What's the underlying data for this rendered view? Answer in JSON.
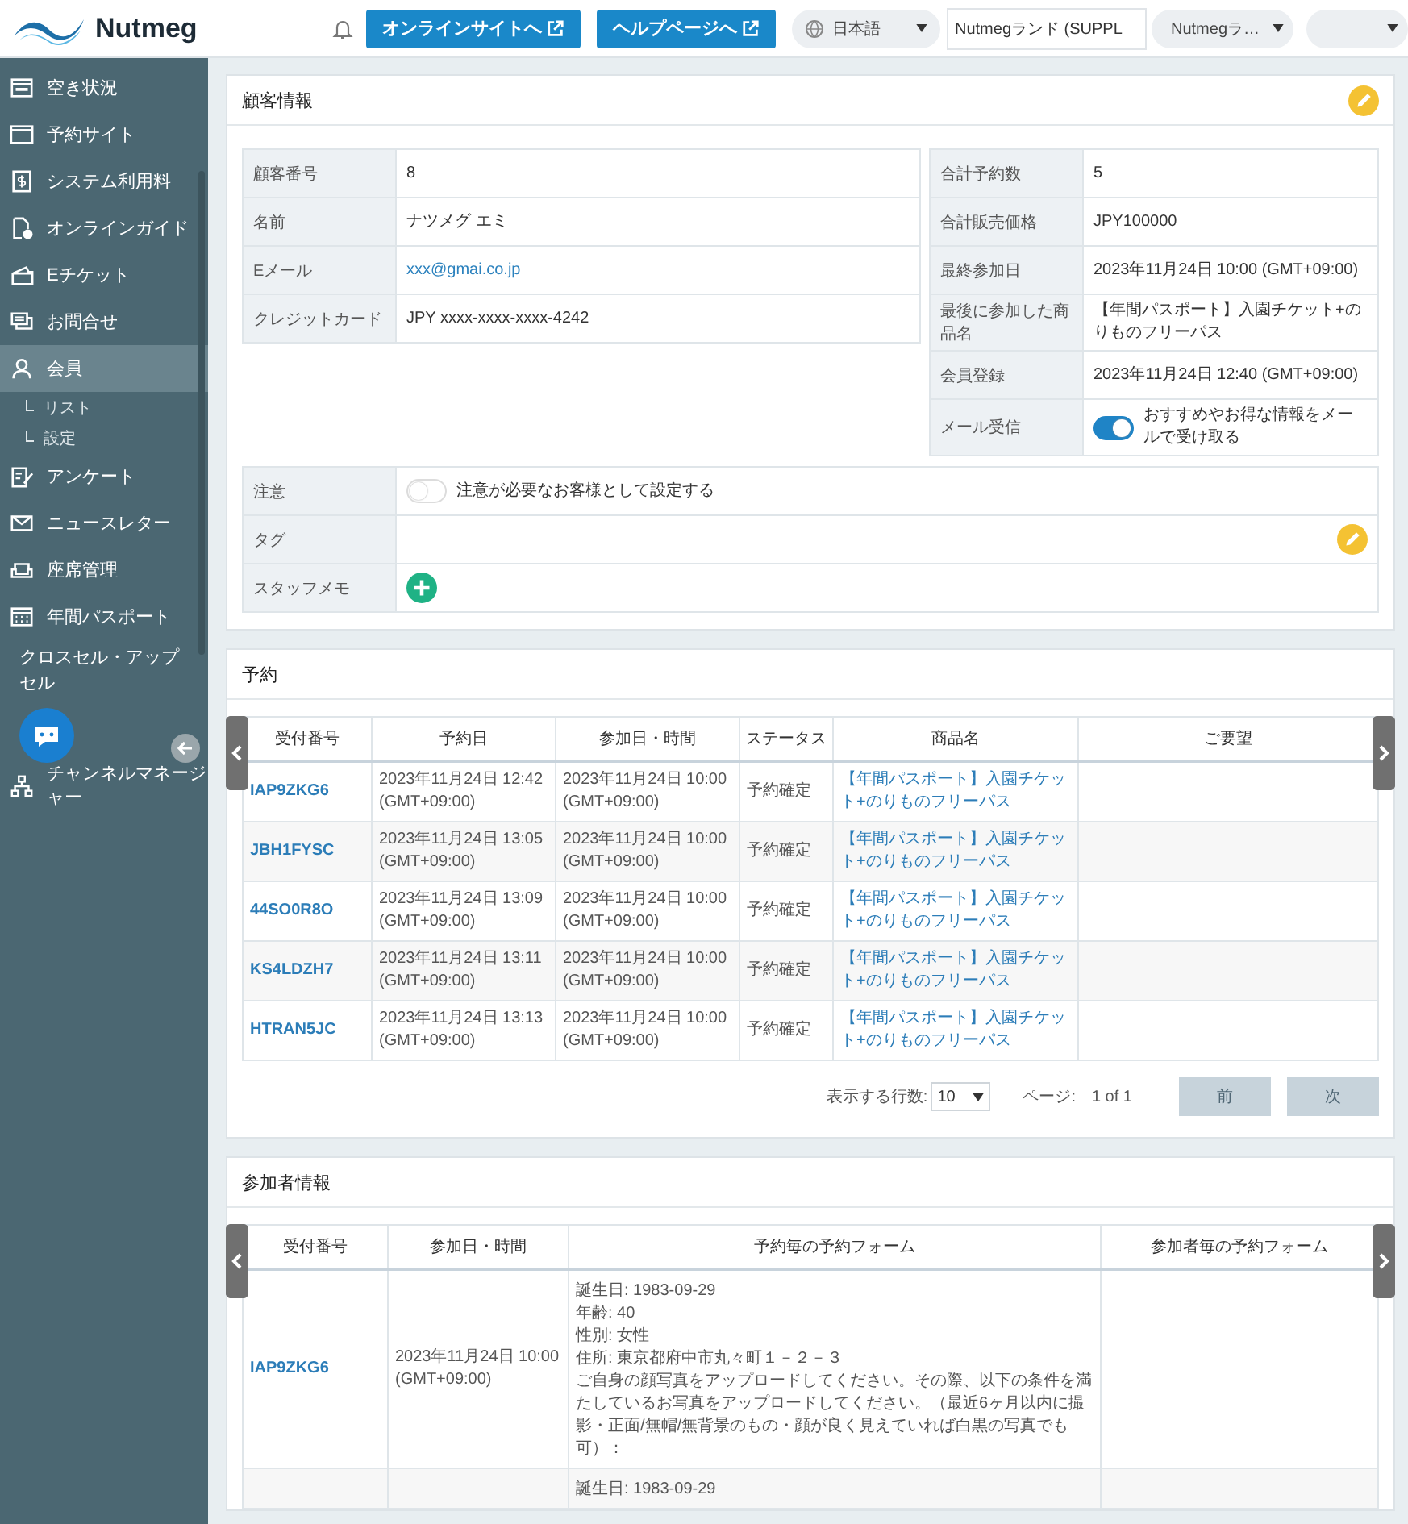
{
  "header": {
    "logo": "Nutmeg",
    "buttons": [
      "オンラインサイトへ",
      "ヘルプページへ"
    ],
    "language": "日本語",
    "site_field": "Nutmegランド (SUPPL",
    "site_select": "Nutmegラ…"
  },
  "sidebar": {
    "items": [
      {
        "label": "空き状況",
        "selected": false
      },
      {
        "label": "予約サイト",
        "selected": false
      },
      {
        "label": "システム利用料",
        "selected": false
      },
      {
        "label": "オンラインガイド",
        "selected": false
      },
      {
        "label": "Eチケット",
        "selected": false
      },
      {
        "label": "お問合せ",
        "selected": false
      },
      {
        "label": "会員",
        "selected": true,
        "children": [
          {
            "label": "リスト"
          },
          {
            "label": "設定"
          }
        ]
      },
      {
        "label": "アンケート",
        "selected": false
      },
      {
        "label": "ニュースレター",
        "selected": false
      },
      {
        "label": "座席管理",
        "selected": false
      },
      {
        "label": "年間パスポート",
        "selected": false
      },
      {
        "label": "クロスセル・アップセル",
        "selected": false
      },
      {
        "label": "チャンネルマネージャー",
        "selected": false
      }
    ]
  },
  "customer": {
    "title": "顧客情報",
    "left_rows": [
      {
        "kind": "text",
        "label": "顧客番号",
        "value": "8"
      },
      {
        "kind": "text",
        "label": "名前",
        "value": "ナツメグ エミ"
      },
      {
        "kind": "link",
        "label": "Eメール",
        "value": "xxx@gmai.co.jp"
      },
      {
        "kind": "text",
        "label": "クレジットカード",
        "value": "JPY xxxx-xxxx-xxxx-4242"
      }
    ],
    "right_rows": [
      {
        "kind": "text",
        "label": "合計予約数",
        "value": "5"
      },
      {
        "kind": "text",
        "label": "合計販売価格",
        "value": "JPY100000"
      },
      {
        "kind": "text",
        "label": "最終参加日",
        "value": "2023年11月24日 10:00 (GMT+09:00)"
      },
      {
        "kind": "text",
        "label": "最後に参加した商品名",
        "value": "【年間パスポート】入園チケット+のりものフリーパス"
      },
      {
        "kind": "text",
        "label": "会員登録",
        "value": "2023年11月24日 12:40 (GMT+09:00)"
      },
      {
        "kind": "toggle",
        "label": "メール受信",
        "on": true,
        "value": "おすすめやお得な情報をメールで受け取る"
      }
    ],
    "bottom_rows": [
      {
        "kind": "toggle",
        "label": "注意",
        "on": false,
        "value": "注意が必要なお客様として設定する"
      },
      {
        "kind": "tag",
        "label": "タグ"
      },
      {
        "kind": "memo",
        "label": "スタッフメモ"
      }
    ]
  },
  "reservations": {
    "title": "予約",
    "columns": [
      "受付番号",
      "予約日",
      "参加日・時間",
      "ステータス",
      "商品名",
      "ご要望"
    ],
    "rows": [
      {
        "id": "IAP9ZKG6",
        "booked": "2023年11月24日 12:42 (GMT+09:00)",
        "date": "2023年11月24日 10:00 (GMT+09:00)",
        "status": "予約確定",
        "product": "【年間パスポート】入園チケット+のりものフリーパス"
      },
      {
        "id": "JBH1FYSC",
        "booked": "2023年11月24日 13:05 (GMT+09:00)",
        "date": "2023年11月24日 10:00 (GMT+09:00)",
        "status": "予約確定",
        "product": "【年間パスポート】入園チケット+のりものフリーパス"
      },
      {
        "id": "44SO0R8O",
        "booked": "2023年11月24日 13:09 (GMT+09:00)",
        "date": "2023年11月24日 10:00 (GMT+09:00)",
        "status": "予約確定",
        "product": "【年間パスポート】入園チケット+のりものフリーパス"
      },
      {
        "id": "KS4LDZH7",
        "booked": "2023年11月24日 13:11 (GMT+09:00)",
        "date": "2023年11月24日 10:00 (GMT+09:00)",
        "status": "予約確定",
        "product": "【年間パスポート】入園チケット+のりものフリーパス"
      },
      {
        "id": "HTRAN5JC",
        "booked": "2023年11月24日 13:13 (GMT+09:00)",
        "date": "2023年11月24日 10:00 (GMT+09:00)",
        "status": "予約確定",
        "product": "【年間パスポート】入園チケット+のりものフリーパス"
      }
    ],
    "pager": {
      "rows_label": "表示する行数:",
      "rows_value": "10",
      "page_label": "ページ:",
      "page_value": "1 of 1",
      "buttons": [
        {
          "label": "前",
          "disabled": true
        },
        {
          "label": "次",
          "disabled": true
        }
      ]
    }
  },
  "participants": {
    "title": "参加者情報",
    "columns": [
      "受付番号",
      "参加日・時間",
      "予約毎の予約フォーム",
      "参加者毎の予約フォーム"
    ],
    "rows": [
      {
        "id": "IAP9ZKG6",
        "date": "2023年11月24日 10:00 (GMT+09:00)",
        "form_lines": [
          "誕生日: 1983-09-29",
          "年齢: 40",
          "性別: 女性",
          "住所: 東京都府中市丸々町１－２－３",
          "ご自身の顔写真をアップロードしてください。その際、以下の条件を満たしているお写真をアップロードしてください。（最近6ヶ月以内に撮影・正面/無帽/無背景のもの・顔が良く見えていれば白黒の写真でも可）："
        ]
      },
      {
        "form_lines": [
          "誕生日: 1983-09-29"
        ]
      }
    ]
  }
}
